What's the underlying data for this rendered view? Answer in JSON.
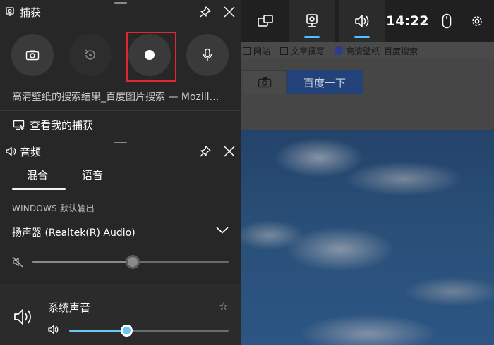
{
  "browser": {
    "bookmarks": [
      "网站",
      "文章撰写",
      "高清壁纸_百度搜索"
    ],
    "search_button": "百度一下"
  },
  "gamebar": {
    "time": "14:22",
    "widgets": [
      "widget-icon",
      "capture-icon",
      "audio-icon"
    ],
    "active_widgets": [
      "capture",
      "audio"
    ],
    "accent": "#4cc2ff"
  },
  "capture": {
    "title": "捕获",
    "buttons": [
      "screenshot",
      "record-last-30s",
      "start-recording",
      "microphone"
    ],
    "caption": "高清壁纸的搜索结果_百度图片搜索 — Mozill…",
    "view_captures": "查看我的捕获",
    "highlight_color": "#e0282d"
  },
  "audio": {
    "title": "音频",
    "tabs": [
      "混合",
      "语音"
    ],
    "active_tab": "混合",
    "section_label": "WINDOWS 默认输出",
    "device": "扬声器 (Realtek(R) Audio)",
    "device_volume": 0.51,
    "device_muted": true,
    "app_name": "系统声音",
    "app_volume": 0.36,
    "app_accent": "#6cc6f5"
  }
}
